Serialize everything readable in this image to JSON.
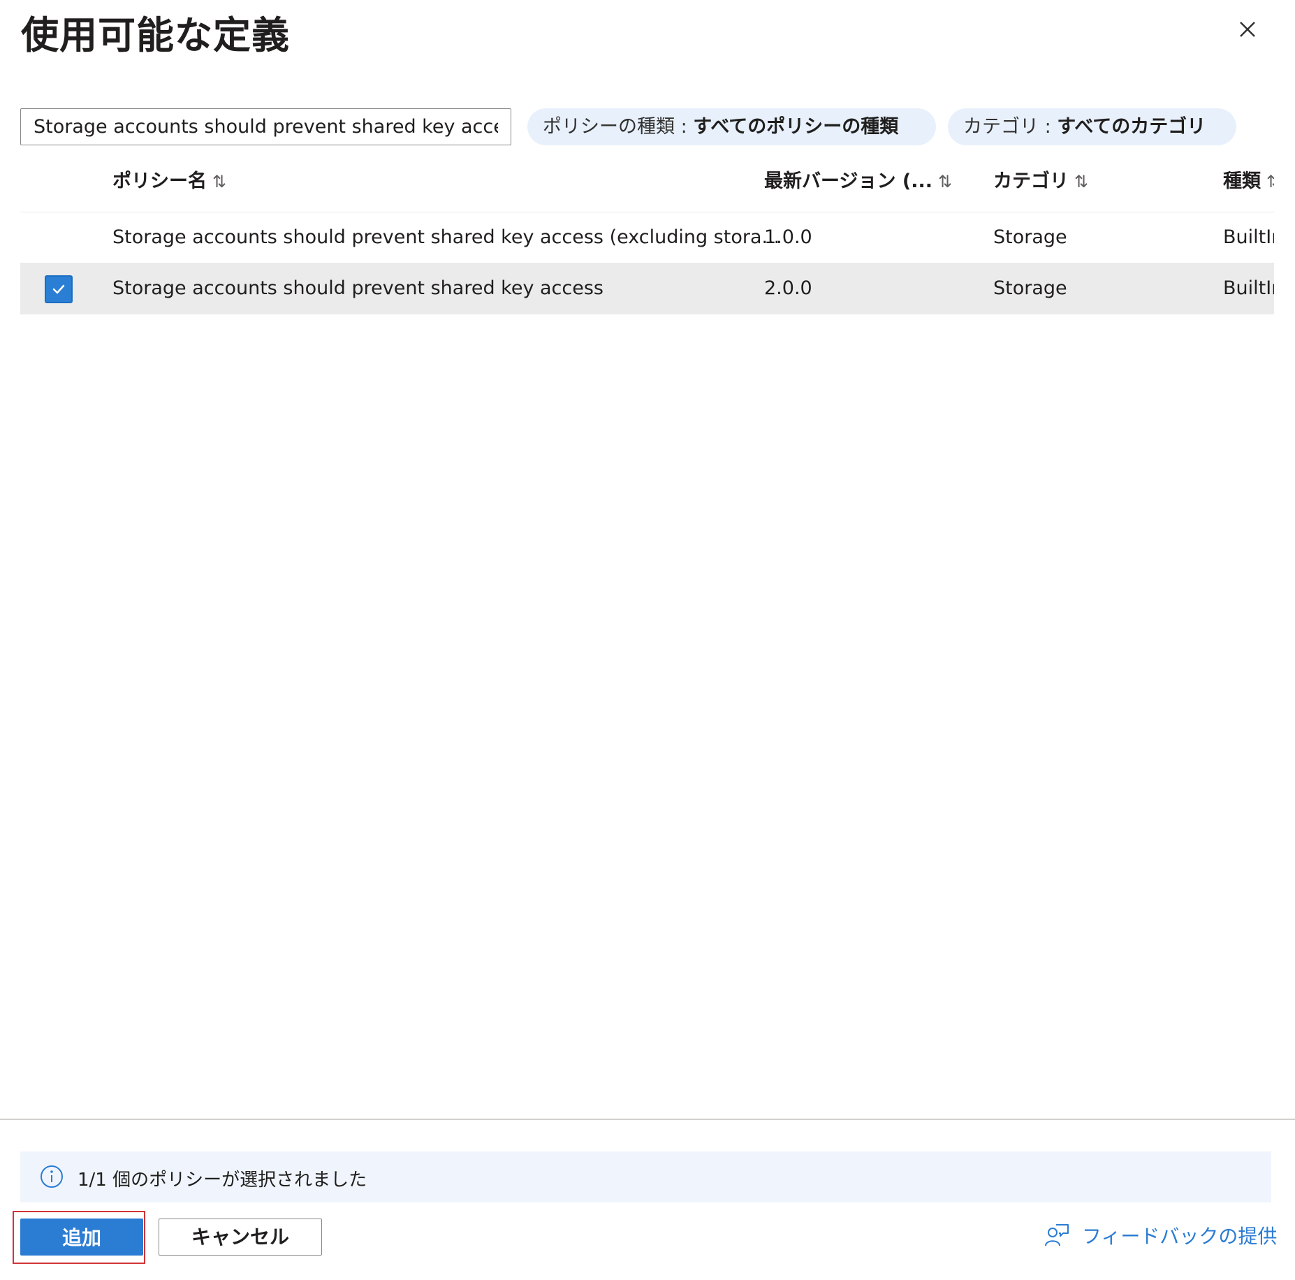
{
  "panel": {
    "title": "使用可能な定義"
  },
  "search": {
    "value": "Storage accounts should prevent shared key access"
  },
  "filters": {
    "policy_type": {
      "label": "ポリシーの種類 : ",
      "value": "すべてのポリシーの種類"
    },
    "category": {
      "label": "カテゴリ : ",
      "value": "すべてのカテゴリ"
    }
  },
  "table": {
    "headers": {
      "name": "ポリシー名",
      "version": "最新バージョン (...",
      "category": "カテゴリ",
      "type": "種類"
    },
    "sort_glyph": "⇅",
    "rows": [
      {
        "name": "Storage accounts should prevent shared key access (excluding stora...",
        "version": "1.0.0",
        "category": "Storage",
        "type": "BuiltIn",
        "selected": false
      },
      {
        "name": "Storage accounts should prevent shared key access",
        "version": "2.0.0",
        "category": "Storage",
        "type": "BuiltIn",
        "selected": true
      }
    ]
  },
  "footer": {
    "info_text": "1/1 個のポリシーが選択されました",
    "add_label": "追加",
    "cancel_label": "キャンセル",
    "feedback_label": "フィードバックの提供"
  },
  "colors": {
    "accent": "#2b7cd3",
    "selected_row": "#ebebeb",
    "highlight_frame": "#d13438",
    "pill_bg": "#e8f1fb",
    "info_bg": "#f0f5fd"
  },
  "icons": {
    "close": "close-icon",
    "checkbox": "checkmark-icon",
    "info": "info-icon",
    "feedback": "feedback-person-icon"
  }
}
